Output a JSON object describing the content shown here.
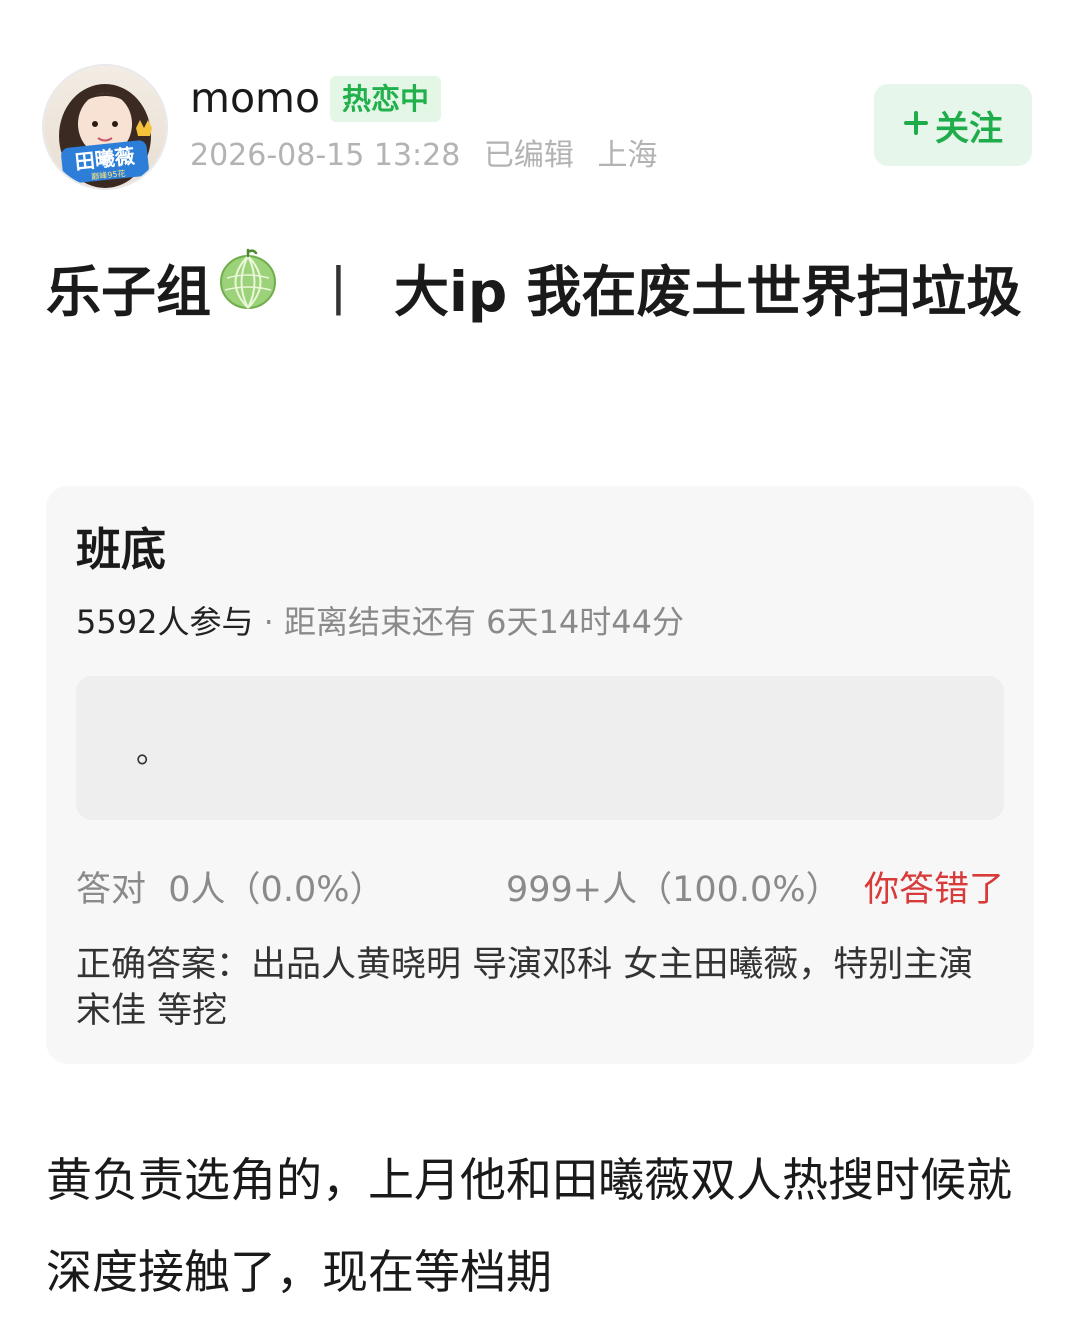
{
  "author": {
    "username": "momo",
    "status_badge": "热恋中",
    "avatar_tag": "田曦薇",
    "avatar_sub": "巅峰95花",
    "timestamp": "2026-08-15 13:28",
    "edited": "已编辑",
    "location": "上海"
  },
  "follow_button": {
    "label": "关注",
    "icon": "plus-icon"
  },
  "post": {
    "title_part1": "乐子组",
    "title_icon": "melon-icon",
    "title_sep": "丨",
    "title_part2": "大ip 我在废土世界扫垃圾",
    "body": "黄负责选角的，上月他和田曦薇双人热搜时候就深度接触了，现在等档期"
  },
  "quiz": {
    "title": "班底",
    "participants": "5592人参与",
    "dot": " · ",
    "time_left": "距离结束还有 6天14时44分",
    "option_text": "。",
    "correct_label": "答对",
    "correct_count": "0人（0.0%）",
    "wrong_count": "999+人（100.0%）",
    "result_status": "你答错了",
    "answer_label": "正确答案：",
    "answer_text": "出品人黄晓明 导演邓科 女主田曦薇，特别主演宋佳 等挖"
  },
  "colors": {
    "accent_green": "#21b04b",
    "badge_bg": "#e4f7e7",
    "wrong_red": "#d83a3a",
    "card_bg": "#f7f7f7"
  }
}
